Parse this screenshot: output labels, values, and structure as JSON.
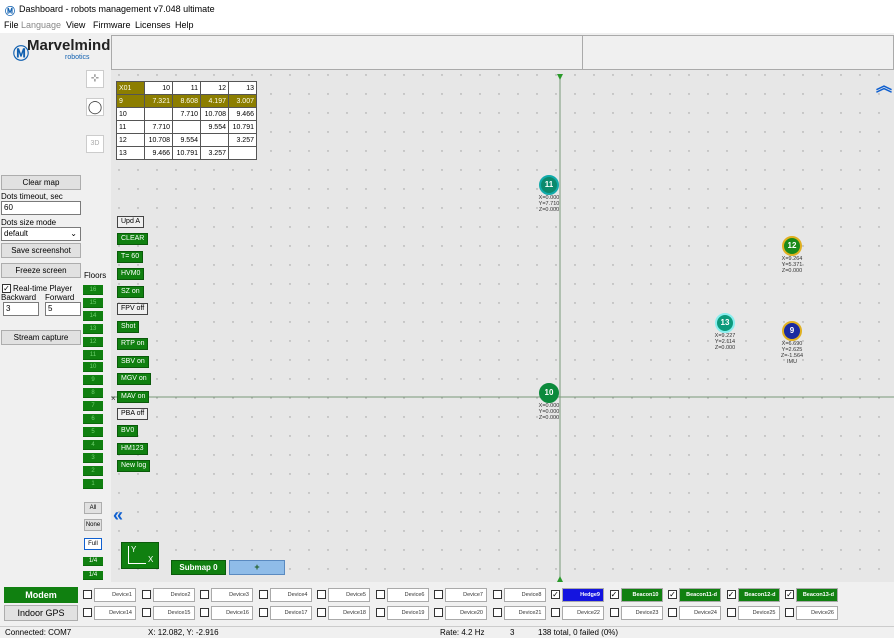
{
  "window": {
    "title": "Dashboard - robots management  v7.048  ultimate"
  },
  "menu": [
    {
      "label": "File",
      "enabled": true
    },
    {
      "label": "Language",
      "enabled": false
    },
    {
      "label": "View",
      "enabled": true
    },
    {
      "label": "Firmware",
      "enabled": true
    },
    {
      "label": "Licenses",
      "enabled": true
    },
    {
      "label": "Help",
      "enabled": true
    }
  ],
  "logo": {
    "brand": "Marvelmind",
    "sub": "robotics"
  },
  "left": {
    "clear_map": "Clear map",
    "dots_timeout_label": "Dots timeout, sec",
    "dots_timeout_value": "60",
    "dots_size_label": "Dots size mode",
    "dots_size_value": "default",
    "save_screenshot": "Save screenshot",
    "freeze_screen": "Freeze screen",
    "floors_label": "Floors",
    "realtime_player": "Real-time Player",
    "realtime_checked": true,
    "backward_label": "Backward",
    "forward_label": "Forward",
    "backward_value": "3",
    "forward_value": "5",
    "stream_capture": "Stream capture"
  },
  "tools": {
    "mode3d": "3D",
    "all": "All",
    "none": "None",
    "full": "Full",
    "scale1": "1/4",
    "scale2": "1/4"
  },
  "floors": [
    "16",
    "15",
    "14",
    "13",
    "12",
    "11",
    "10",
    "9",
    "8",
    "7",
    "6",
    "5",
    "4",
    "3",
    "2",
    "1"
  ],
  "distance_table": {
    "header": [
      "X01",
      "10",
      "11",
      "12",
      "13"
    ],
    "rows": [
      [
        "9",
        "7.321",
        "8.608",
        "4.197",
        "3.007"
      ],
      [
        "10",
        "",
        "7.710",
        "10.708",
        "9.466"
      ],
      [
        "11",
        "7.710",
        "",
        "9.554",
        "10.791"
      ],
      [
        "12",
        "10.708",
        "9.554",
        "",
        "3.257"
      ],
      [
        "13",
        "9.466",
        "10.791",
        "3.257",
        ""
      ]
    ]
  },
  "map_buttons": [
    {
      "label": "Upd A",
      "style": "white"
    },
    {
      "label": "CLEAR",
      "style": "green"
    },
    {
      "label": "T= 60",
      "style": "green"
    },
    {
      "label": "HVM0",
      "style": "green"
    },
    {
      "label": "SZ on",
      "style": "green"
    },
    {
      "label": "FPV off",
      "style": "white"
    },
    {
      "label": "Shot",
      "style": "green"
    },
    {
      "label": "RTP on",
      "style": "green"
    },
    {
      "label": "SBV on",
      "style": "green"
    },
    {
      "label": "MGV on",
      "style": "green"
    },
    {
      "label": "MAV on",
      "style": "green"
    },
    {
      "label": "PBA off",
      "style": "white"
    },
    {
      "label": "BV0",
      "style": "green"
    },
    {
      "label": "HM123",
      "style": "green"
    },
    {
      "label": "New log",
      "style": "green"
    }
  ],
  "beacons": [
    {
      "id": "11",
      "coords": "X=0.000\nY=7.710\nZ=0.000",
      "color": "#0c8a6c",
      "ring": "#1aa",
      "extra": ""
    },
    {
      "id": "10",
      "coords": "X=0.000\nY=0.000\nZ=0.000",
      "color": "#0c8a3c",
      "ring": "#0c8a3c",
      "extra": ""
    },
    {
      "id": "12",
      "coords": "X=9.264\nY=5.371\nZ=0.000",
      "color": "#1a8a1a",
      "ring": "#e0b020",
      "extra": ""
    },
    {
      "id": "13",
      "coords": "X=9.227\nY=2.114\nZ=0.000",
      "color": "#0c9a7c",
      "ring": "#8ee",
      "extra": ""
    },
    {
      "id": "9",
      "coords": "X=6.690\nY=2.625\nZ=-1.564",
      "color": "#1a2aa0",
      "ring": "#e0b020",
      "extra": "IMU"
    }
  ],
  "axes": {
    "x": "X",
    "y": "Y"
  },
  "submap": {
    "label": "Submap 0",
    "add": "+"
  },
  "bottom": {
    "modem": "Modem",
    "indoor_gps": "Indoor GPS",
    "row1": [
      {
        "label": "Device1",
        "checked": false,
        "style": "plain"
      },
      {
        "label": "Device2",
        "checked": false,
        "style": "plain"
      },
      {
        "label": "Device3",
        "checked": false,
        "style": "plain"
      },
      {
        "label": "Device4",
        "checked": false,
        "style": "plain"
      },
      {
        "label": "Device5",
        "checked": false,
        "style": "plain"
      },
      {
        "label": "Device6",
        "checked": false,
        "style": "plain"
      },
      {
        "label": "Device7",
        "checked": false,
        "style": "plain"
      },
      {
        "label": "Device8",
        "checked": false,
        "style": "plain"
      },
      {
        "label": "Hedge9",
        "checked": true,
        "style": "blue"
      },
      {
        "label": "Beacon10",
        "checked": true,
        "style": "green"
      },
      {
        "label": "Beacon11-d",
        "checked": true,
        "style": "green"
      },
      {
        "label": "Beacon12-d",
        "checked": true,
        "style": "green"
      },
      {
        "label": "Beacon13-d",
        "checked": true,
        "style": "green"
      }
    ],
    "row2": [
      "Device14",
      "Device15",
      "Device16",
      "Device17",
      "Device18",
      "Device19",
      "Device20",
      "Device21",
      "Device22",
      "Device23",
      "Device24",
      "Device25",
      "Device26"
    ]
  },
  "status": {
    "connected": "Connected: COM7",
    "cursor": "X: 12.082, Y: -2.916",
    "rate": "Rate: 4.2 Hz",
    "count": "3",
    "total": "138 total, 0 failed (0%)"
  },
  "colors": {
    "green": "#108010",
    "blue": "#1414e0",
    "olive": "#8c7e00"
  }
}
